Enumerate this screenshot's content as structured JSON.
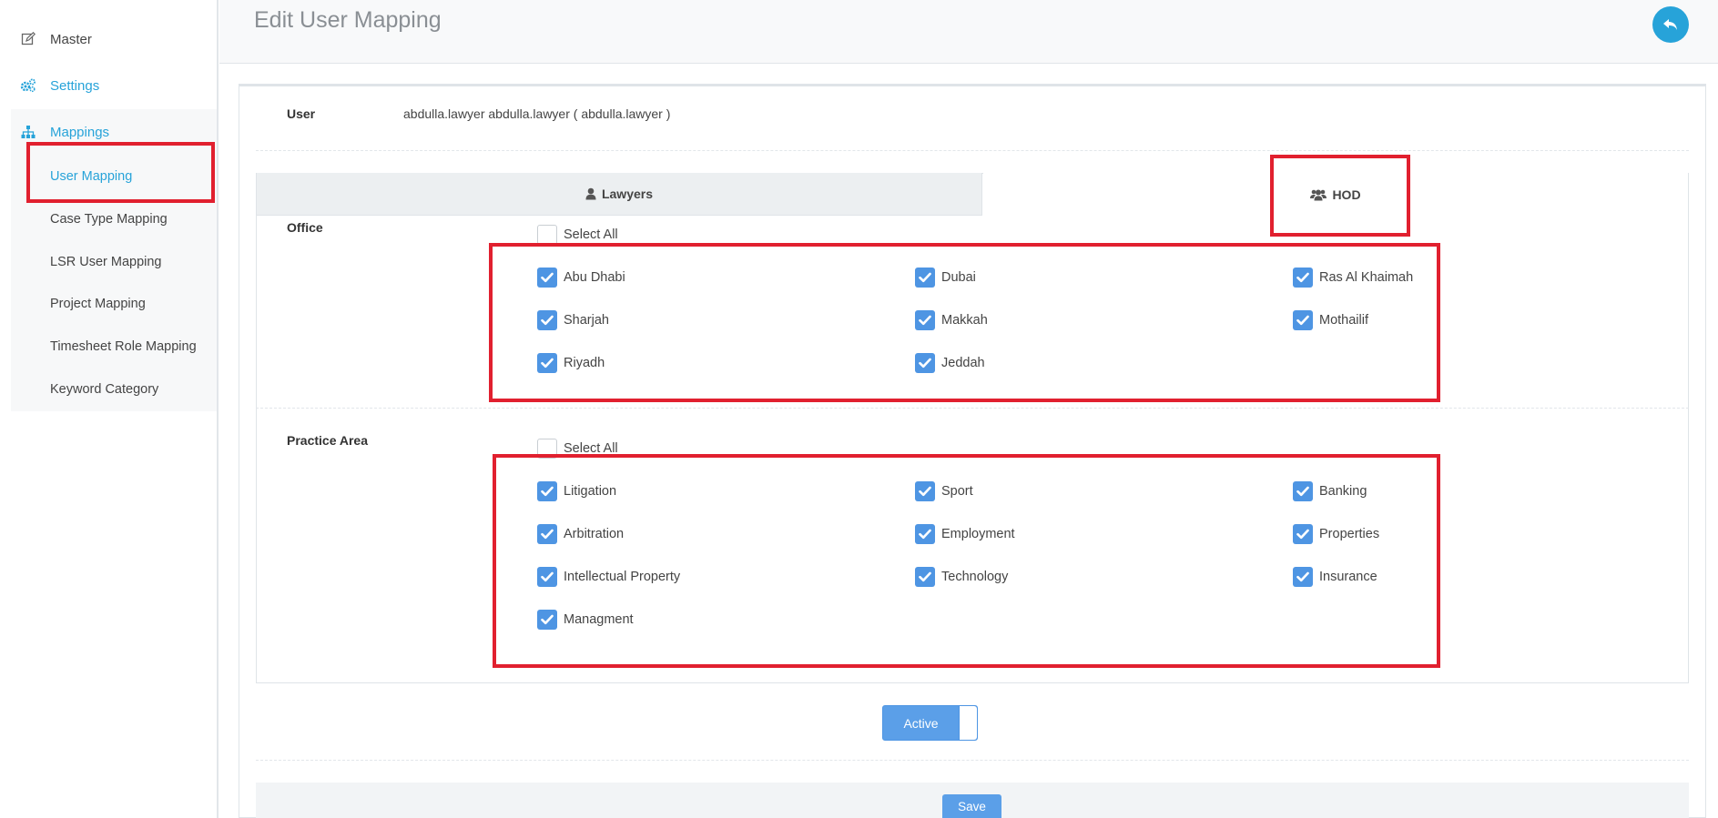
{
  "sidebar": {
    "items": [
      {
        "label": "Master",
        "icon": "edit-icon"
      },
      {
        "label": "Settings",
        "icon": "gears-icon"
      },
      {
        "label": "Mappings",
        "icon": "sitemap-icon"
      }
    ],
    "submenu": [
      {
        "label": "User Mapping",
        "active": true
      },
      {
        "label": "Case Type Mapping"
      },
      {
        "label": "LSR User Mapping"
      },
      {
        "label": "Project Mapping"
      },
      {
        "label": "Timesheet Role Mapping"
      },
      {
        "label": "Keyword Category"
      }
    ]
  },
  "header": {
    "title": "Edit User Mapping",
    "back_icon": "reply-icon"
  },
  "user": {
    "label": "User",
    "value": "abdulla.lawyer abdulla.lawyer   ( abdulla.lawyer )"
  },
  "tabs": [
    {
      "label": "Lawyers",
      "icon": "user-icon"
    },
    {
      "label": "HOD",
      "icon": "users-icon"
    }
  ],
  "office": {
    "label": "Office",
    "select_all": "Select All",
    "options": [
      {
        "label": "Abu Dhabi",
        "checked": true
      },
      {
        "label": "Dubai",
        "checked": true
      },
      {
        "label": "Ras Al Khaimah",
        "checked": true
      },
      {
        "label": "Sharjah",
        "checked": true
      },
      {
        "label": "Makkah",
        "checked": true
      },
      {
        "label": "Mothailif",
        "checked": true
      },
      {
        "label": "Riyadh",
        "checked": true
      },
      {
        "label": "Jeddah",
        "checked": true
      }
    ]
  },
  "practice_area": {
    "label": "Practice Area",
    "select_all": "Select All",
    "options": [
      {
        "label": "Litigation",
        "checked": true
      },
      {
        "label": "Sport",
        "checked": true
      },
      {
        "label": "Banking",
        "checked": true
      },
      {
        "label": "Arbitration",
        "checked": true
      },
      {
        "label": "Employment",
        "checked": true
      },
      {
        "label": "Properties",
        "checked": true
      },
      {
        "label": "Intellectual Property",
        "checked": true
      },
      {
        "label": "Technology",
        "checked": true
      },
      {
        "label": "Insurance",
        "checked": true
      },
      {
        "label": "Managment",
        "checked": true
      }
    ]
  },
  "toggle": {
    "label": "Active"
  },
  "actions": {
    "save_label": "Save"
  },
  "colors": {
    "accent": "#27a3d9",
    "checkbox": "#4e95e3",
    "annotation": "#e1202f"
  }
}
